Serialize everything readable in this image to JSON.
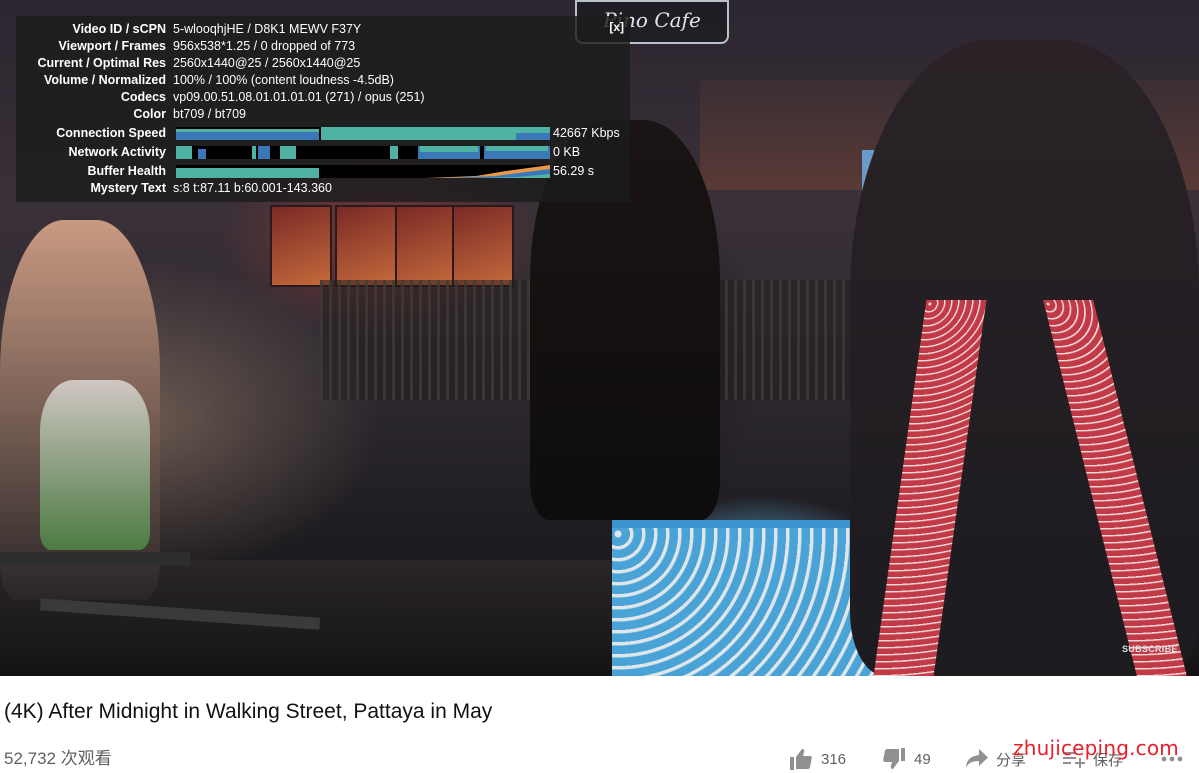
{
  "stats_overlay": {
    "close_label": "[x]",
    "rows": [
      {
        "label": "Video ID / sCPN",
        "value": "5-wlooqhjHE / D8K1 MEWV F37Y"
      },
      {
        "label": "Viewport / Frames",
        "value": "956x538*1.25 / 0 dropped of 773"
      },
      {
        "label": "Current / Optimal Res",
        "value": "2560x1440@25 / 2560x1440@25"
      },
      {
        "label": "Volume / Normalized",
        "value": "100% / 100% (content loudness -4.5dB)"
      },
      {
        "label": "Codecs",
        "value": "vp09.00.51.08.01.01.01.01 (271) / opus (251)"
      },
      {
        "label": "Color",
        "value": "bt709 / bt709"
      }
    ],
    "graphs": [
      {
        "label": "Connection Speed",
        "value": "42667 Kbps"
      },
      {
        "label": "Network Activity",
        "value": "0 KB"
      },
      {
        "label": "Buffer Health",
        "value": "56.29 s"
      }
    ],
    "mystery": {
      "label": "Mystery Text",
      "value": "s:8 t:87.11 b:60.001-143.360"
    }
  },
  "video": {
    "sign_text": "Pino Cafe",
    "watermark": "SUBSCRIBE"
  },
  "info": {
    "title": "(4K) After Midnight in Walking Street, Pattaya in May",
    "views": "52,732 次观看",
    "likes": "316",
    "dislikes": "49",
    "share_label": "分享",
    "save_label": "保存"
  },
  "site_watermark": "zhujiceping.com",
  "colors": {
    "graph_teal": "#4fb3a3",
    "graph_blue": "#3b78b8",
    "graph_orange": "#e89a4a",
    "watermark_red": "#e8202a"
  }
}
